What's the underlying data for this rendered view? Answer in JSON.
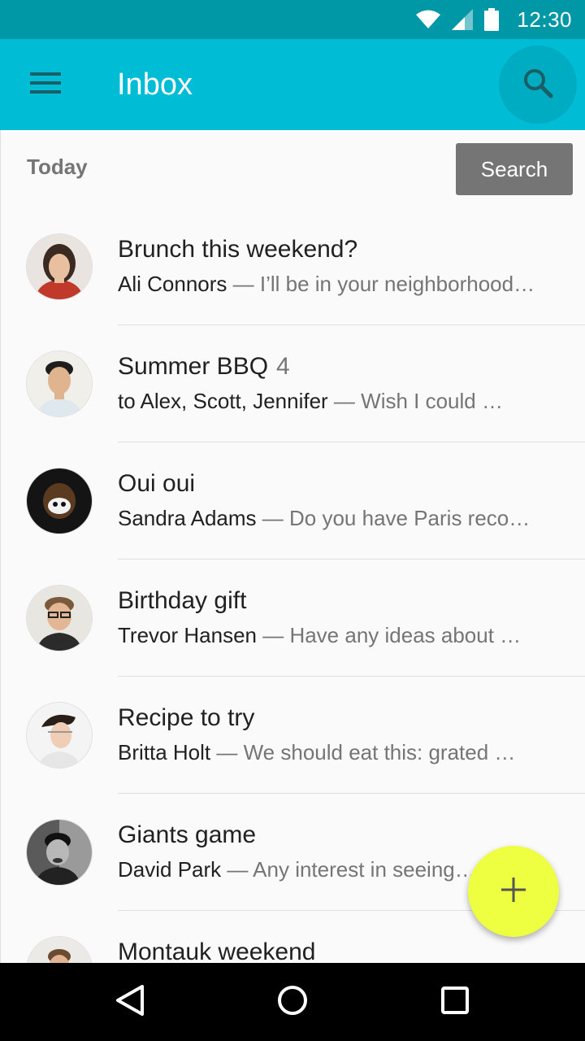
{
  "status_bar": {
    "time": "12:30",
    "icons": [
      "wifi-icon",
      "signal-icon",
      "battery-icon"
    ]
  },
  "app_bar": {
    "title": "Inbox",
    "menu_icon": "menu-icon",
    "search_icon": "search-icon",
    "color": "#00bcd4"
  },
  "section": {
    "header": "Today",
    "search_button": "Search"
  },
  "messages": [
    {
      "subject": "Brunch this weekend?",
      "count": "",
      "sender": "Ali Connors",
      "preview": " — I’ll be in your neighborhood…"
    },
    {
      "subject": "Summer BBQ",
      "count": "4",
      "sender": "to Alex, Scott, Jennifer",
      "preview": " — Wish I could …"
    },
    {
      "subject": "Oui oui",
      "count": "",
      "sender": "Sandra Adams",
      "preview": " — Do you have Paris reco…"
    },
    {
      "subject": "Birthday gift",
      "count": "",
      "sender": "Trevor Hansen",
      "preview": " — Have any ideas about …"
    },
    {
      "subject": "Recipe to try",
      "count": "",
      "sender": "Britta Holt",
      "preview": " — We should eat this: grated …"
    },
    {
      "subject": "Giants game",
      "count": "",
      "sender": "David Park",
      "preview": " — Any interest in seeing…"
    },
    {
      "subject": "Montauk weekend",
      "count": "",
      "sender": "",
      "preview": ""
    }
  ],
  "fab": {
    "icon": "plus-icon",
    "color": "#eeff41"
  },
  "nav_bar": {
    "icons": [
      "back-icon",
      "home-icon",
      "recents-icon"
    ]
  }
}
